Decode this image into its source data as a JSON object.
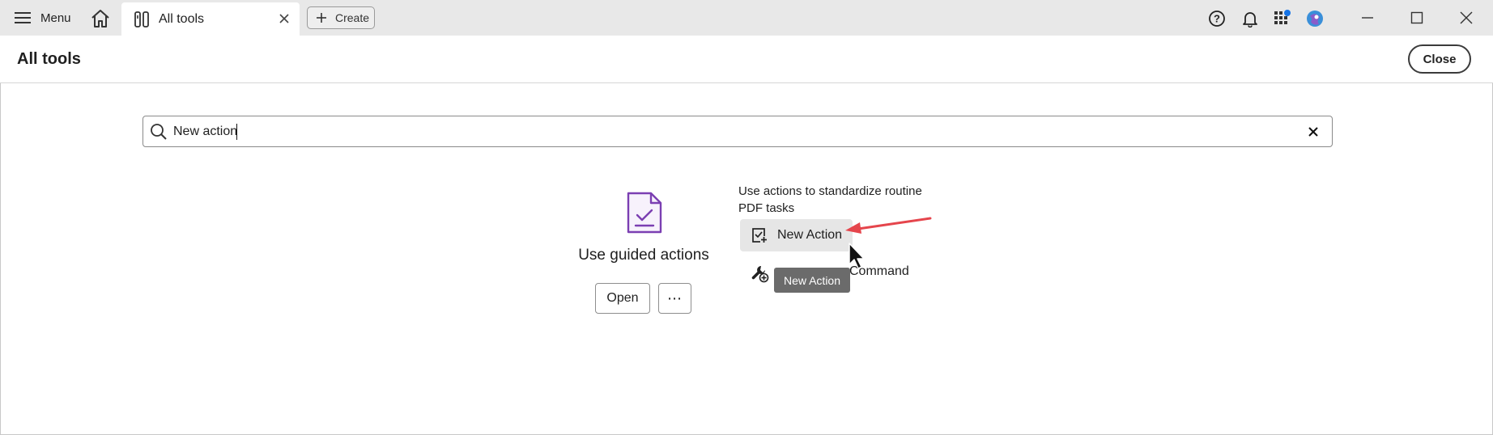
{
  "titlebar": {
    "menu_label": "Menu",
    "tab_label": "All tools",
    "create_label": "Create"
  },
  "header": {
    "title": "All tools",
    "close_label": "Close"
  },
  "search": {
    "value": "New action",
    "placeholder": ""
  },
  "tool_card": {
    "title": "Use guided actions",
    "open_label": "Open",
    "more_label": "⋯",
    "description": "Use actions to standardize routine PDF tasks",
    "new_action_label": "New Action",
    "command_label": "Command",
    "tooltip": "New Action"
  },
  "colors": {
    "titlebar_bg": "#e8e8e8",
    "accent_purple": "#7b3fb2",
    "annotation_arrow": "#e5454c",
    "notification_dot": "#1473e6"
  },
  "icons": [
    "hamburger-icon",
    "home-icon",
    "tools-icon",
    "close-icon",
    "plus-icon",
    "help-icon",
    "bell-icon",
    "apps-icon",
    "avatar",
    "minimize-icon",
    "maximize-icon",
    "window-close-icon",
    "search-icon",
    "clear-icon",
    "document-check-icon",
    "new-action-icon",
    "wrench-add-icon",
    "mouse-cursor-icon"
  ]
}
